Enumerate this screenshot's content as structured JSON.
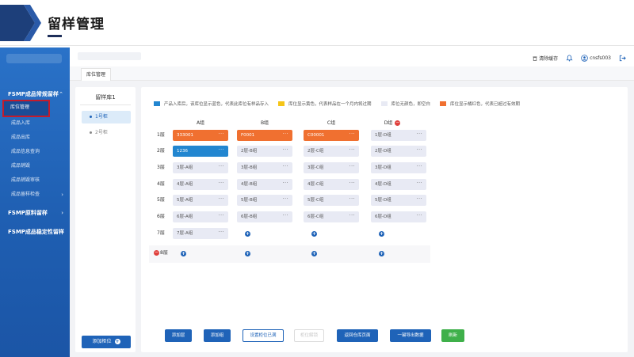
{
  "page_title": "留样管理",
  "colors": {
    "sidebar": "#1f5fb2",
    "primary": "#1f63b8",
    "orange": "#f07030",
    "blue": "#2286d0",
    "yellow": "#f5c518",
    "empty": "#e8eaf4",
    "highlight": "#c51b2b",
    "green": "#3fb04a"
  },
  "header": {
    "clear_cache": "清除缓存",
    "username": "cnsfs003"
  },
  "sidebar": {
    "groups": [
      {
        "label": "FSMP成品常规留样",
        "chevron": "⌃"
      },
      {
        "label": "FSMP原料留样",
        "chevron": "›"
      },
      {
        "label": "FSMP成品稳定性留样",
        "chevron": "›"
      }
    ],
    "items": [
      {
        "label": "库位管理"
      },
      {
        "label": "成品入库"
      },
      {
        "label": "成品出库"
      },
      {
        "label": "成品信息查询"
      },
      {
        "label": "成品销毁"
      },
      {
        "label": "成品销毁审核"
      },
      {
        "label": "成品留样检查"
      }
    ]
  },
  "tabs": [
    {
      "label": "库位管理"
    }
  ],
  "store": {
    "title": "留样库1",
    "groups": [
      {
        "label": "1号柜"
      },
      {
        "label": "2号柜"
      }
    ],
    "add_shelf_label": "添加柜位"
  },
  "legend": [
    {
      "color": "#2286d0",
      "text": "产品入库后，该库位显示蓝色，代表此库位有样品存入"
    },
    {
      "color": "#f5c518",
      "text": "库位显示黄色，代表样品在一个月内将过期"
    },
    {
      "color": "#e8eaf4",
      "text": "库位无颜色，即空白"
    },
    {
      "color": "#f07030",
      "text": "库位显示橘红色，代表已超过有效期"
    }
  ],
  "columns": [
    {
      "label": "A组"
    },
    {
      "label": "B组"
    },
    {
      "label": "C组"
    },
    {
      "label": "D组",
      "removable": true
    }
  ],
  "rows": [
    {
      "label": "1层",
      "cells": [
        {
          "text": "333001",
          "state": "orange"
        },
        {
          "text": "F0001",
          "state": "orange"
        },
        {
          "text": "C00001",
          "state": "orange"
        },
        {
          "text": "1层-D组",
          "state": "empty"
        }
      ]
    },
    {
      "label": "2层",
      "cells": [
        {
          "text": "1236",
          "state": "blue"
        },
        {
          "text": "2层-B组",
          "state": "empty"
        },
        {
          "text": "2层-C组",
          "state": "empty"
        },
        {
          "text": "2层-D组",
          "state": "empty"
        }
      ]
    },
    {
      "label": "3层",
      "cells": [
        {
          "text": "3层-A组",
          "state": "empty"
        },
        {
          "text": "3层-B组",
          "state": "empty"
        },
        {
          "text": "3层-C组",
          "state": "empty"
        },
        {
          "text": "3层-D组",
          "state": "empty"
        }
      ]
    },
    {
      "label": "4层",
      "cells": [
        {
          "text": "4层-A组",
          "state": "empty"
        },
        {
          "text": "4层-B组",
          "state": "empty"
        },
        {
          "text": "4层-C组",
          "state": "empty"
        },
        {
          "text": "4层-D组",
          "state": "empty"
        }
      ]
    },
    {
      "label": "5层",
      "cells": [
        {
          "text": "5层-A组",
          "state": "empty"
        },
        {
          "text": "5层-B组",
          "state": "empty"
        },
        {
          "text": "5层-C组",
          "state": "empty"
        },
        {
          "text": "5层-D组",
          "state": "empty"
        }
      ]
    },
    {
      "label": "6层",
      "cells": [
        {
          "text": "6层-A组",
          "state": "empty"
        },
        {
          "text": "6层-B组",
          "state": "empty"
        },
        {
          "text": "6层-C组",
          "state": "empty"
        },
        {
          "text": "6层-D组",
          "state": "empty"
        }
      ]
    },
    {
      "label": "7层",
      "cells": [
        {
          "text": "7层-A组",
          "state": "empty"
        },
        {
          "text": "",
          "state": "add"
        },
        {
          "text": "",
          "state": "add"
        },
        {
          "text": "",
          "state": "add"
        }
      ]
    },
    {
      "label": "8层",
      "removable": true,
      "cells": [
        {
          "text": "",
          "state": "add"
        },
        {
          "text": "",
          "state": "add"
        },
        {
          "text": "",
          "state": "add"
        },
        {
          "text": "",
          "state": "add"
        }
      ]
    }
  ],
  "cell_menu": "···",
  "add_symbol": "+",
  "remove_symbol": "−",
  "buttons": [
    {
      "label": "添加层",
      "style": "primary"
    },
    {
      "label": "添加组",
      "style": "primary"
    },
    {
      "label": "设置柜位已满",
      "style": "outline"
    },
    {
      "label": "柜位解锁",
      "style": "disabled"
    },
    {
      "label": "返回仓库页面",
      "style": "primary"
    },
    {
      "label": "一键导出数据",
      "style": "primary"
    },
    {
      "label": "刷新",
      "style": "green"
    }
  ]
}
